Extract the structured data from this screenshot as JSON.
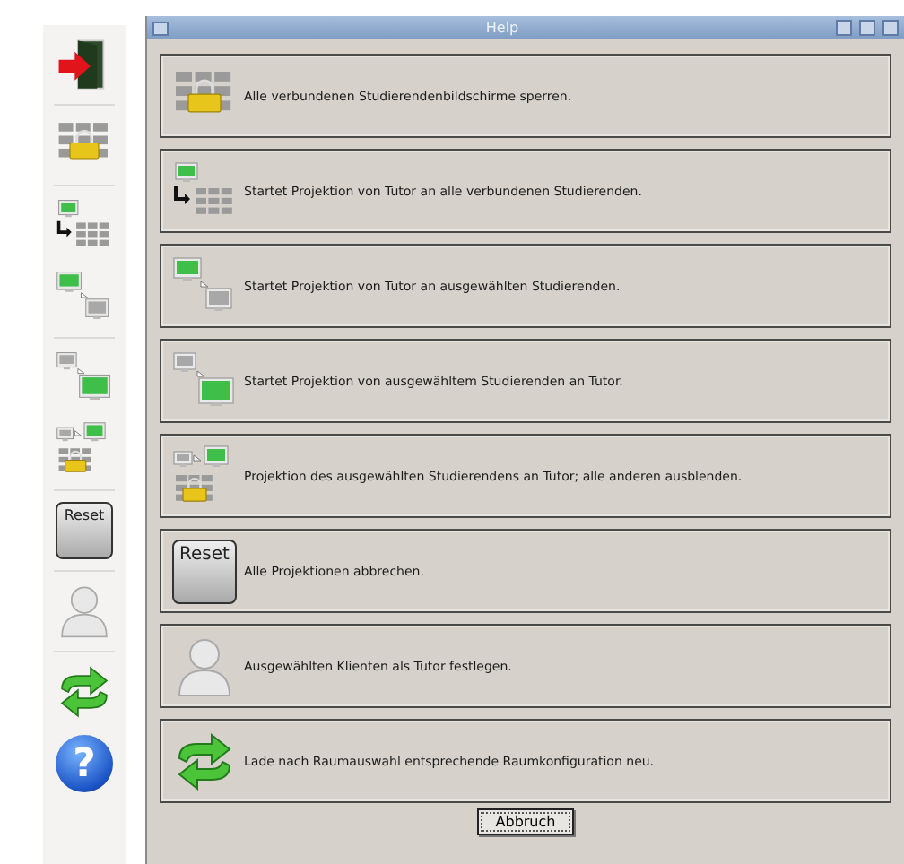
{
  "sidebar": {
    "items": [
      {
        "kind": "exit",
        "separator_after": true
      },
      {
        "kind": "lock",
        "separator_after": true
      },
      {
        "kind": "project-all",
        "separator_after": false
      },
      {
        "kind": "project-selected",
        "separator_after": true
      },
      {
        "kind": "project-to-tutor",
        "separator_after": false
      },
      {
        "kind": "project-exclusive",
        "separator_after": true
      },
      {
        "kind": "reset",
        "label": "Reset",
        "separator_after": true
      },
      {
        "kind": "person",
        "separator_after": true
      },
      {
        "kind": "refresh",
        "separator_after": false
      },
      {
        "kind": "help",
        "label": "?",
        "separator_after": false
      }
    ]
  },
  "window": {
    "title": "Help"
  },
  "rows": [
    {
      "kind": "lock",
      "text": "Alle verbundenen Studierendenbildschirme sperren."
    },
    {
      "kind": "project-all",
      "text": "Startet Projektion von Tutor an alle verbundenen Studierenden."
    },
    {
      "kind": "project-selected",
      "text": "Startet Projektion von Tutor an ausgewählten Studierenden."
    },
    {
      "kind": "project-to-tutor",
      "text": "Startet Projektion von ausgewähltem Studierenden an Tutor."
    },
    {
      "kind": "project-exclusive",
      "text": "Projektion des ausgewählten Studierendens an Tutor; alle anderen ausblenden."
    },
    {
      "kind": "reset",
      "label": "Reset",
      "text": "Alle Projektionen abbrechen."
    },
    {
      "kind": "person",
      "text": "Ausgewählten Klienten als Tutor festlegen."
    },
    {
      "kind": "refresh",
      "text": "Lade nach Raumauswahl entsprechende Raumkonfiguration neu."
    }
  ],
  "button": "Abbruch"
}
